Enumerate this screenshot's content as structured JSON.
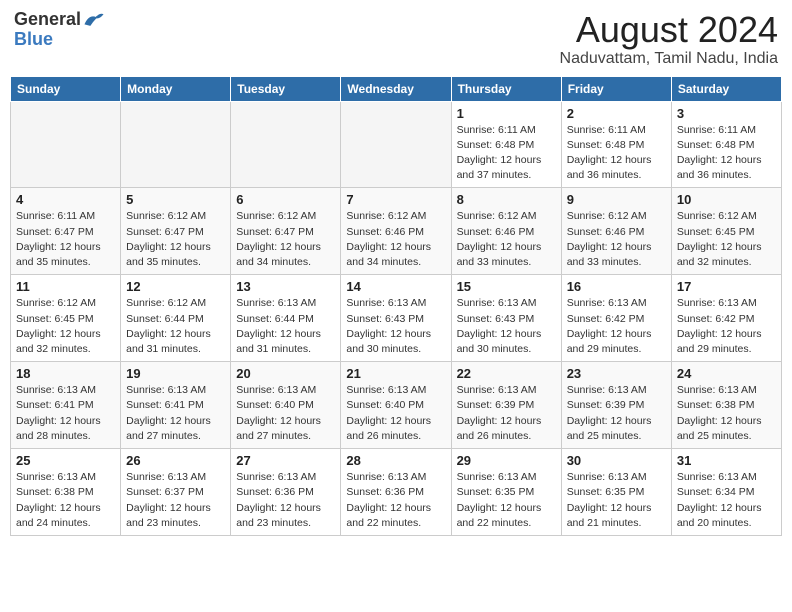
{
  "logo": {
    "general": "General",
    "blue": "Blue"
  },
  "title": "August 2024",
  "subtitle": "Naduvattam, Tamil Nadu, India",
  "days_of_week": [
    "Sunday",
    "Monday",
    "Tuesday",
    "Wednesday",
    "Thursday",
    "Friday",
    "Saturday"
  ],
  "weeks": [
    [
      {
        "day": "",
        "info": ""
      },
      {
        "day": "",
        "info": ""
      },
      {
        "day": "",
        "info": ""
      },
      {
        "day": "",
        "info": ""
      },
      {
        "day": "1",
        "info": "Sunrise: 6:11 AM\nSunset: 6:48 PM\nDaylight: 12 hours\nand 37 minutes."
      },
      {
        "day": "2",
        "info": "Sunrise: 6:11 AM\nSunset: 6:48 PM\nDaylight: 12 hours\nand 36 minutes."
      },
      {
        "day": "3",
        "info": "Sunrise: 6:11 AM\nSunset: 6:48 PM\nDaylight: 12 hours\nand 36 minutes."
      }
    ],
    [
      {
        "day": "4",
        "info": "Sunrise: 6:11 AM\nSunset: 6:47 PM\nDaylight: 12 hours\nand 35 minutes."
      },
      {
        "day": "5",
        "info": "Sunrise: 6:12 AM\nSunset: 6:47 PM\nDaylight: 12 hours\nand 35 minutes."
      },
      {
        "day": "6",
        "info": "Sunrise: 6:12 AM\nSunset: 6:47 PM\nDaylight: 12 hours\nand 34 minutes."
      },
      {
        "day": "7",
        "info": "Sunrise: 6:12 AM\nSunset: 6:46 PM\nDaylight: 12 hours\nand 34 minutes."
      },
      {
        "day": "8",
        "info": "Sunrise: 6:12 AM\nSunset: 6:46 PM\nDaylight: 12 hours\nand 33 minutes."
      },
      {
        "day": "9",
        "info": "Sunrise: 6:12 AM\nSunset: 6:46 PM\nDaylight: 12 hours\nand 33 minutes."
      },
      {
        "day": "10",
        "info": "Sunrise: 6:12 AM\nSunset: 6:45 PM\nDaylight: 12 hours\nand 32 minutes."
      }
    ],
    [
      {
        "day": "11",
        "info": "Sunrise: 6:12 AM\nSunset: 6:45 PM\nDaylight: 12 hours\nand 32 minutes."
      },
      {
        "day": "12",
        "info": "Sunrise: 6:12 AM\nSunset: 6:44 PM\nDaylight: 12 hours\nand 31 minutes."
      },
      {
        "day": "13",
        "info": "Sunrise: 6:13 AM\nSunset: 6:44 PM\nDaylight: 12 hours\nand 31 minutes."
      },
      {
        "day": "14",
        "info": "Sunrise: 6:13 AM\nSunset: 6:43 PM\nDaylight: 12 hours\nand 30 minutes."
      },
      {
        "day": "15",
        "info": "Sunrise: 6:13 AM\nSunset: 6:43 PM\nDaylight: 12 hours\nand 30 minutes."
      },
      {
        "day": "16",
        "info": "Sunrise: 6:13 AM\nSunset: 6:42 PM\nDaylight: 12 hours\nand 29 minutes."
      },
      {
        "day": "17",
        "info": "Sunrise: 6:13 AM\nSunset: 6:42 PM\nDaylight: 12 hours\nand 29 minutes."
      }
    ],
    [
      {
        "day": "18",
        "info": "Sunrise: 6:13 AM\nSunset: 6:41 PM\nDaylight: 12 hours\nand 28 minutes."
      },
      {
        "day": "19",
        "info": "Sunrise: 6:13 AM\nSunset: 6:41 PM\nDaylight: 12 hours\nand 27 minutes."
      },
      {
        "day": "20",
        "info": "Sunrise: 6:13 AM\nSunset: 6:40 PM\nDaylight: 12 hours\nand 27 minutes."
      },
      {
        "day": "21",
        "info": "Sunrise: 6:13 AM\nSunset: 6:40 PM\nDaylight: 12 hours\nand 26 minutes."
      },
      {
        "day": "22",
        "info": "Sunrise: 6:13 AM\nSunset: 6:39 PM\nDaylight: 12 hours\nand 26 minutes."
      },
      {
        "day": "23",
        "info": "Sunrise: 6:13 AM\nSunset: 6:39 PM\nDaylight: 12 hours\nand 25 minutes."
      },
      {
        "day": "24",
        "info": "Sunrise: 6:13 AM\nSunset: 6:38 PM\nDaylight: 12 hours\nand 25 minutes."
      }
    ],
    [
      {
        "day": "25",
        "info": "Sunrise: 6:13 AM\nSunset: 6:38 PM\nDaylight: 12 hours\nand 24 minutes."
      },
      {
        "day": "26",
        "info": "Sunrise: 6:13 AM\nSunset: 6:37 PM\nDaylight: 12 hours\nand 23 minutes."
      },
      {
        "day": "27",
        "info": "Sunrise: 6:13 AM\nSunset: 6:36 PM\nDaylight: 12 hours\nand 23 minutes."
      },
      {
        "day": "28",
        "info": "Sunrise: 6:13 AM\nSunset: 6:36 PM\nDaylight: 12 hours\nand 22 minutes."
      },
      {
        "day": "29",
        "info": "Sunrise: 6:13 AM\nSunset: 6:35 PM\nDaylight: 12 hours\nand 22 minutes."
      },
      {
        "day": "30",
        "info": "Sunrise: 6:13 AM\nSunset: 6:35 PM\nDaylight: 12 hours\nand 21 minutes."
      },
      {
        "day": "31",
        "info": "Sunrise: 6:13 AM\nSunset: 6:34 PM\nDaylight: 12 hours\nand 20 minutes."
      }
    ]
  ]
}
